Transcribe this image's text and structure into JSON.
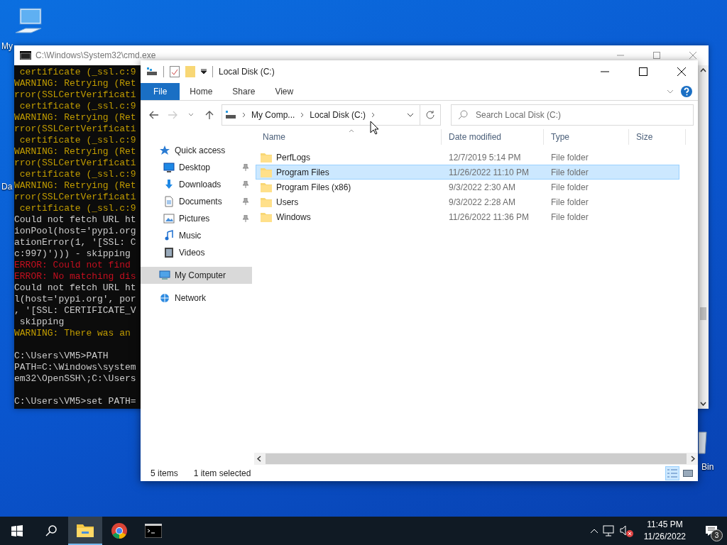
{
  "desktop_icons": [
    {
      "kind": "computer",
      "label": "My"
    },
    {
      "kind": "blank",
      "label": "Da"
    },
    {
      "kind": "bin",
      "label": "Bin"
    }
  ],
  "console": {
    "title": "C:\\Windows\\System32\\cmd.exe",
    "lines": [
      {
        "kind": "warning",
        "text": " certificate (_ssl.c:9"
      },
      {
        "kind": "warning",
        "text": "WARNING: Retrying (Ret"
      },
      {
        "kind": "warning",
        "text": "rror(SSLCertVerificati"
      },
      {
        "kind": "warning",
        "text": " certificate (_ssl.c:9"
      },
      {
        "kind": "warning",
        "text": "WARNING: Retrying (Ret"
      },
      {
        "kind": "warning",
        "text": "rror(SSLCertVerificati"
      },
      {
        "kind": "warning",
        "text": " certificate (_ssl.c:9"
      },
      {
        "kind": "warning",
        "text": "WARNING: Retrying (Ret"
      },
      {
        "kind": "warning",
        "text": "rror(SSLCertVerificati"
      },
      {
        "kind": "warning",
        "text": " certificate (_ssl.c:9"
      },
      {
        "kind": "warning",
        "text": "WARNING: Retrying (Ret"
      },
      {
        "kind": "warning",
        "text": "rror(SSLCertVerificati"
      },
      {
        "kind": "warning",
        "text": " certificate (_ssl.c:9"
      },
      {
        "kind": "normal",
        "text": "Could not fetch URL ht"
      },
      {
        "kind": "normal",
        "text": "ionPool(host='pypi.org"
      },
      {
        "kind": "normal",
        "text": "ationError(1, '[SSL: C"
      },
      {
        "kind": "normal",
        "text": "c:997)'))) - skipping"
      },
      {
        "kind": "error",
        "text": "ERROR: Could not find"
      },
      {
        "kind": "error",
        "text": "ERROR: No matching dis"
      },
      {
        "kind": "normal",
        "text": "Could not fetch URL ht"
      },
      {
        "kind": "normal",
        "text": "l(host='pypi.org', por"
      },
      {
        "kind": "normal",
        "text": ", '[SSL: CERTIFICATE_V"
      },
      {
        "kind": "normal",
        "text": " skipping"
      },
      {
        "kind": "warning",
        "text": "WARNING: There was an"
      },
      {
        "kind": "blank"
      },
      {
        "kind": "normal",
        "text": "C:\\Users\\VM5>PATH"
      },
      {
        "kind": "normal",
        "text": "PATH=C:\\Windows\\system"
      },
      {
        "kind": "normal",
        "text": "em32\\OpenSSH\\;C:\\Users"
      },
      {
        "kind": "blank"
      },
      {
        "kind": "normal",
        "text": "C:\\Users\\VM5>set PATH="
      }
    ]
  },
  "explorer": {
    "title": "Local Disk (C:)",
    "ribbon_tabs": [
      {
        "label": "File",
        "selected": true
      },
      {
        "label": "Home",
        "selected": false
      },
      {
        "label": "Share",
        "selected": false
      },
      {
        "label": "View",
        "selected": false
      }
    ],
    "forward_disabled": true,
    "breadcrumb": [
      "My Comp...",
      "Local Disk (C:)"
    ],
    "search": {
      "placeholder": "Search Local Disk (C:)"
    },
    "nav_tree": [
      {
        "kind": "star",
        "label": "Quick access",
        "selected": false,
        "children": [
          {
            "kind": "desktop",
            "label": "Desktop",
            "pinned": true,
            "selected": false
          },
          {
            "kind": "download",
            "label": "Downloads",
            "pinned": true,
            "selected": false
          },
          {
            "kind": "document",
            "label": "Documents",
            "pinned": true,
            "selected": false
          },
          {
            "kind": "picture",
            "label": "Pictures",
            "pinned": true,
            "selected": false
          },
          {
            "kind": "music",
            "label": "Music",
            "pinned": false,
            "selected": false
          },
          {
            "kind": "video",
            "label": "Videos",
            "pinned": false,
            "selected": false
          }
        ]
      },
      {
        "kind": "computer",
        "label": "My Computer",
        "selected": true
      },
      {
        "kind": "network",
        "label": "Network",
        "selected": false
      }
    ],
    "columns": [
      {
        "label": "Name",
        "sorted": true
      },
      {
        "label": "Date modified",
        "sorted": false
      },
      {
        "label": "Type",
        "sorted": false
      },
      {
        "label": "Size",
        "sorted": false
      }
    ],
    "rows": [
      {
        "name": "PerfLogs",
        "date": "12/7/2019 5:14 PM",
        "type": "File folder",
        "selected": false
      },
      {
        "name": "Program Files",
        "date": "11/26/2022 11:10 PM",
        "type": "File folder",
        "selected": true
      },
      {
        "name": "Program Files (x86)",
        "date": "9/3/2022 2:30 AM",
        "type": "File folder",
        "selected": false
      },
      {
        "name": "Users",
        "date": "9/3/2022 2:28 AM",
        "type": "File folder",
        "selected": false
      },
      {
        "name": "Windows",
        "date": "11/26/2022 11:36 PM",
        "type": "File folder",
        "selected": false
      }
    ],
    "status": {
      "count": "5 items",
      "selection": "1 item selected"
    },
    "view_buttons": [
      {
        "kind": "details",
        "selected": true
      },
      {
        "kind": "thumbnails",
        "selected": false
      }
    ]
  },
  "taskbar": {
    "apps": [
      {
        "kind": "explorer",
        "active": true
      },
      {
        "kind": "chrome",
        "active": false
      },
      {
        "kind": "console",
        "active": false
      }
    ],
    "time": "11:45 PM",
    "date": "11/26/2022",
    "notifications": "3"
  }
}
